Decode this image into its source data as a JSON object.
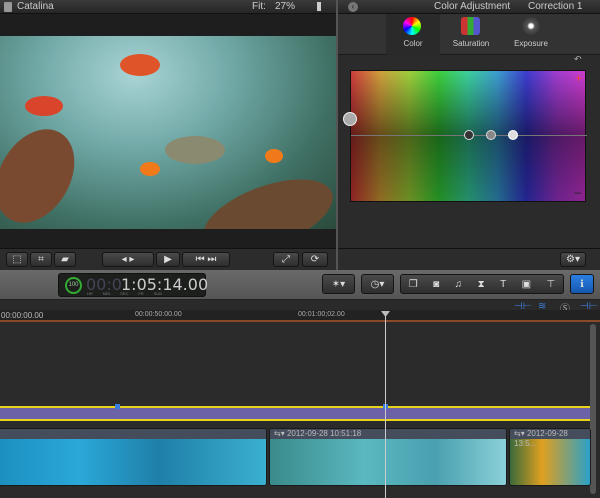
{
  "viewer": {
    "title": "Catalina",
    "fit_label": "Fit:",
    "zoom": "27%"
  },
  "inspector": {
    "title": "Color Adjustment",
    "correction": "Correction 1",
    "tabs": [
      {
        "label": "Color",
        "icon": "color-wheel-icon"
      },
      {
        "label": "Saturation",
        "icon": "saturation-icon"
      },
      {
        "label": "Exposure",
        "icon": "exposure-icon"
      }
    ],
    "active_tab": "Color"
  },
  "timecode": {
    "value": "1:05:14.00",
    "dim_prefix": "00:0",
    "percent": "100",
    "units": [
      "HR",
      "MIN",
      "SEC",
      "FR",
      "SUB"
    ]
  },
  "ruler": {
    "ticks": [
      "00:00:00.00",
      "00:00:50:00.00",
      "00:01:00;02.00"
    ]
  },
  "clips": [
    {
      "label": ""
    },
    {
      "label": "2012-09-28 10:51:18"
    },
    {
      "label": "2012-09-28 13:5..."
    }
  ],
  "colors": {
    "accent": "#1f6fd0",
    "audio_lane": "#6b62a8",
    "audio_line": "#e8d21a"
  }
}
